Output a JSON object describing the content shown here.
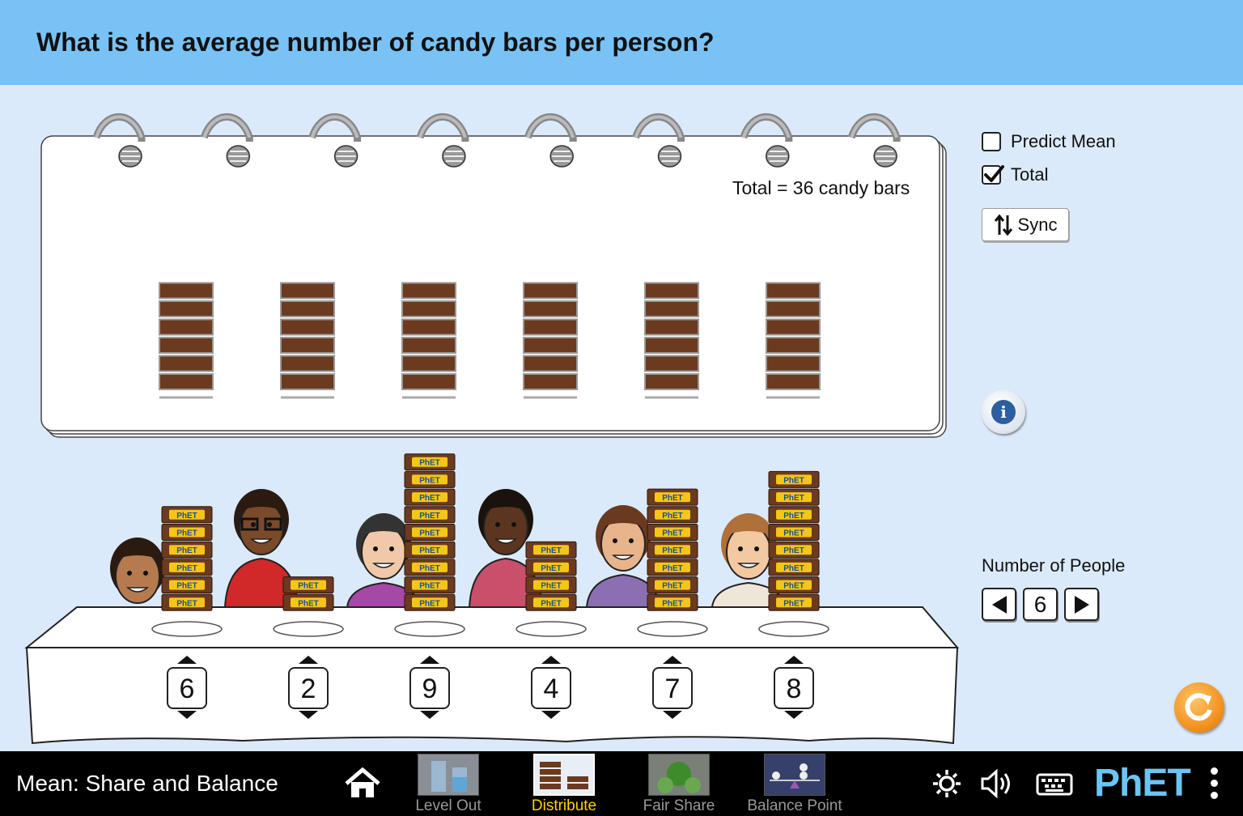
{
  "header": {
    "question": "What is the average number of candy bars per person?"
  },
  "notepad": {
    "total_label": "Total = 36 candy bars",
    "stack_heights": [
      6,
      6,
      6,
      6,
      6,
      6
    ]
  },
  "controls": {
    "predict_mean": {
      "label": "Predict Mean",
      "checked": false
    },
    "total": {
      "label": "Total",
      "checked": true
    },
    "sync_label": "Sync",
    "number_of_people_label": "Number of People",
    "number_of_people_value": "6"
  },
  "people": [
    {
      "count": "6"
    },
    {
      "count": "2"
    },
    {
      "count": "9"
    },
    {
      "count": "4"
    },
    {
      "count": "7"
    },
    {
      "count": "8"
    }
  ],
  "candy_label": "PhET",
  "navbar": {
    "title": "Mean: Share and Balance",
    "screens": [
      {
        "label": "Level Out",
        "active": false
      },
      {
        "label": "Distribute",
        "active": true
      },
      {
        "label": "Fair Share",
        "active": false
      },
      {
        "label": "Balance Point",
        "active": false
      }
    ],
    "logo": "PhET"
  },
  "icons": [
    "home-icon",
    "settings-gear-icon",
    "sound-icon",
    "keyboard-icon",
    "menu-dots-icon",
    "info-icon",
    "reset-icon",
    "sync-arrows-icon",
    "checkmark-icon"
  ],
  "colors": {
    "header": "#79c2f5",
    "background": "#dbeafb",
    "candy": "#6b3a1f",
    "active_screen": "#ffd200",
    "reset": "#f39421"
  }
}
